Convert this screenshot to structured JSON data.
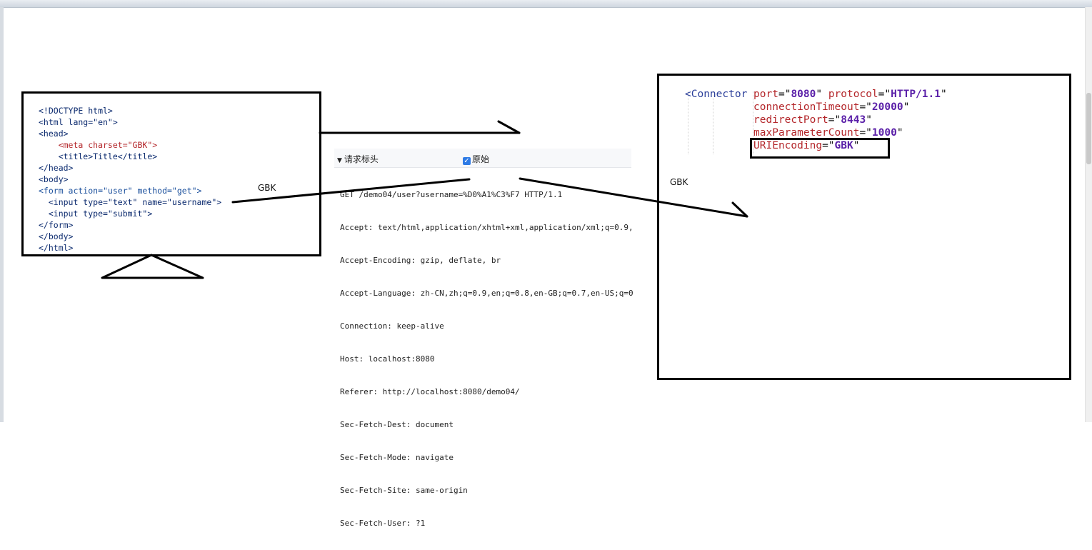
{
  "html_source": {
    "lines": [
      "<!DOCTYPE html>",
      "<html lang=\"en\">",
      "<head>",
      "    <meta charset=\"GBK\">",
      "    <title>Title</title>",
      "</head>",
      "<body>",
      "<form action=\"user\" method=\"get\">",
      "  <input type=\"text\" name=\"username\">",
      "  <input type=\"submit\">",
      "</form>",
      "</body>",
      "</html>"
    ]
  },
  "request_headers": {
    "title": "请求标头",
    "raw_label": "原始",
    "raw_checked": true,
    "lines": [
      "GET /demo04/user?username=%D0%A1%C3%F7 HTTP/1.1",
      "Accept: text/html,application/xhtml+xml,application/xml;q=0.9,",
      "Accept-Encoding: gzip, deflate, br",
      "Accept-Language: zh-CN,zh;q=0.9,en;q=0.8,en-GB;q=0.7,en-US;q=0",
      "Connection: keep-alive",
      "Host: localhost:8080",
      "Referer: http://localhost:8080/demo04/",
      "Sec-Fetch-Dest: document",
      "Sec-Fetch-Mode: navigate",
      "Sec-Fetch-Site: same-origin",
      "Sec-Fetch-User: ?1"
    ]
  },
  "tomcat_connector": {
    "tag": "Connector",
    "attrs": [
      {
        "name": "port",
        "value": "8080"
      },
      {
        "name": "protocol",
        "value": "HTTP/1.1"
      },
      {
        "name": "connectionTimeout",
        "value": "20000"
      },
      {
        "name": "redirectPort",
        "value": "8443"
      },
      {
        "name": "maxParameterCount",
        "value": "1000"
      },
      {
        "name": "URIEncoding",
        "value": "GBK"
      }
    ]
  },
  "labels": {
    "gbk_left": "GBK",
    "gbk_right": "GBK"
  }
}
